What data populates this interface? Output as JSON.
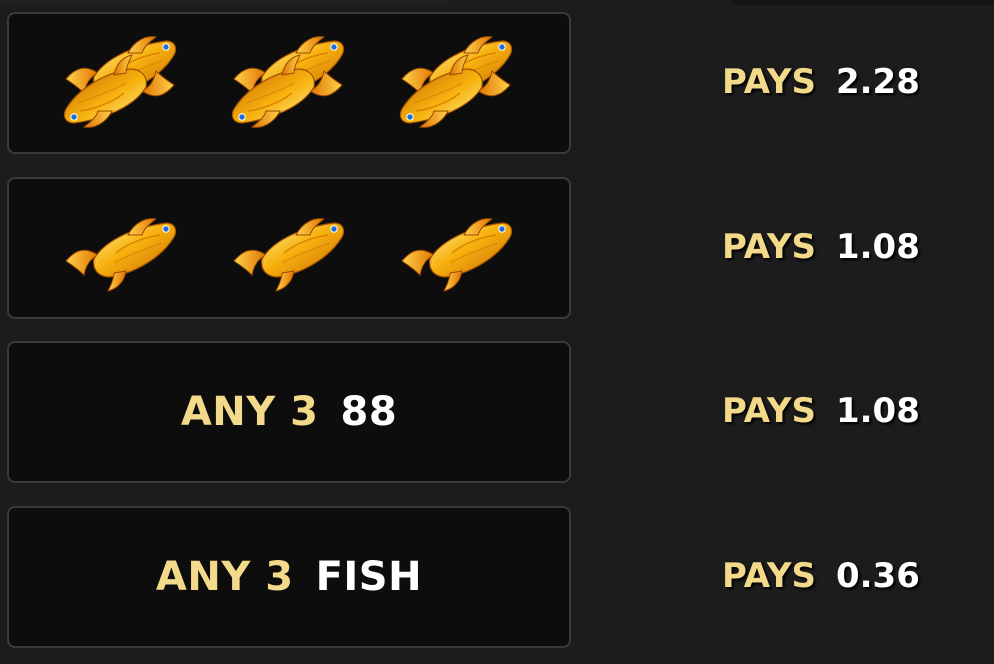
{
  "paytable": {
    "rows": [
      {
        "symbols": [
          "twin-koi-fish-icon",
          "twin-koi-fish-icon",
          "twin-koi-fish-icon"
        ],
        "pays_label": "PAYS",
        "pays_value": "2.28"
      },
      {
        "symbols": [
          "koi-fish-icon",
          "koi-fish-icon",
          "koi-fish-icon"
        ],
        "pays_label": "PAYS",
        "pays_value": "1.08"
      },
      {
        "combo_prefix": "ANY 3",
        "combo_target": "88",
        "pays_label": "PAYS",
        "pays_value": "1.08"
      },
      {
        "combo_prefix": "ANY 3",
        "combo_target": "FISH",
        "pays_label": "PAYS",
        "pays_value": "0.36"
      }
    ]
  },
  "colors": {
    "background": "#1c1c1c",
    "cell_background": "#0d0d0d",
    "cell_border": "#3a3a3a",
    "gold_text": "#f3d98a",
    "white_text": "#ffffff",
    "fish_gold": "#f5a20a"
  }
}
